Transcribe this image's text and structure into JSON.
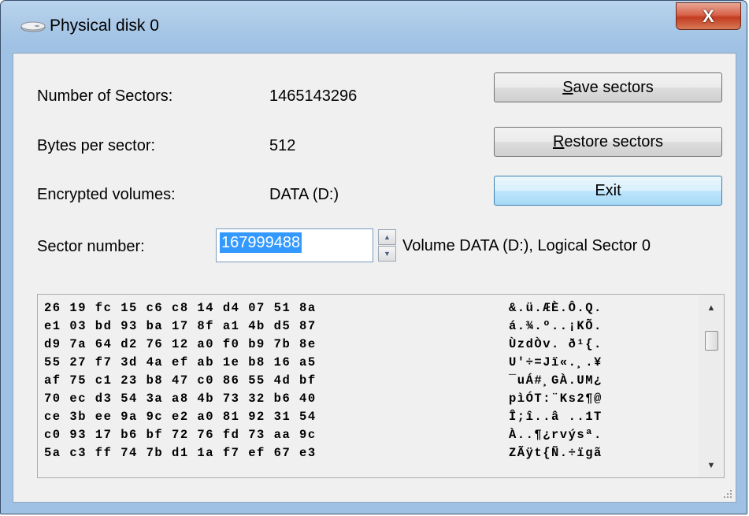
{
  "window": {
    "title": "Physical disk 0",
    "close_symbol": "X",
    "icon": "disk-icon"
  },
  "info": {
    "sectors_label": "Number of Sectors:",
    "sectors_value": "1465143296",
    "bytes_label": "Bytes per sector:",
    "bytes_value": "512",
    "encrypted_label": "Encrypted volumes:",
    "encrypted_value": "DATA (D:)",
    "sector_number_label": "Sector number:",
    "sector_number_value": "167999488",
    "volume_info": "Volume DATA (D:), Logical Sector 0"
  },
  "buttons": {
    "save_key": "S",
    "save_rest": "ave sectors",
    "restore_key": "R",
    "restore_rest": "estore sectors",
    "exit_label": "Exit"
  },
  "hex": {
    "rows": [
      "26 19 fc 15 c6 c8 14 d4 07 51 8a",
      "e1 03 bd 93 ba 17 8f a1 4b d5 87",
      "d9 7a 64 d2 76 12 a0 f0 b9 7b 8e",
      "55 27 f7 3d 4a ef ab 1e b8 16 a5",
      "af 75 c1 23 b8 47 c0 86 55 4d bf",
      "70 ec d3 54 3a a8 4b 73 32 b6 40",
      "ce 3b ee 9a 9c e2 a0 81 92 31 54",
      "c0 93 17 b6 bf 72 76 fd 73 aa 9c",
      "5a c3 ff 74 7b d1 1a f7 ef 67 e3"
    ],
    "ascii": [
      "&.ü.ÆÈ.Ô.Q.",
      "á.¾.º..¡KÕ.",
      "ÙzdÒv. ð¹{.",
      "U'÷=Jï«.¸.¥",
      "¯uÁ#¸GÀ.UM¿",
      "pìÓT:¨Ks2¶@",
      "Î;î..â ..1T",
      "À..¶¿rvýsª.",
      "ZÃÿt{Ñ.÷ïgã"
    ]
  }
}
